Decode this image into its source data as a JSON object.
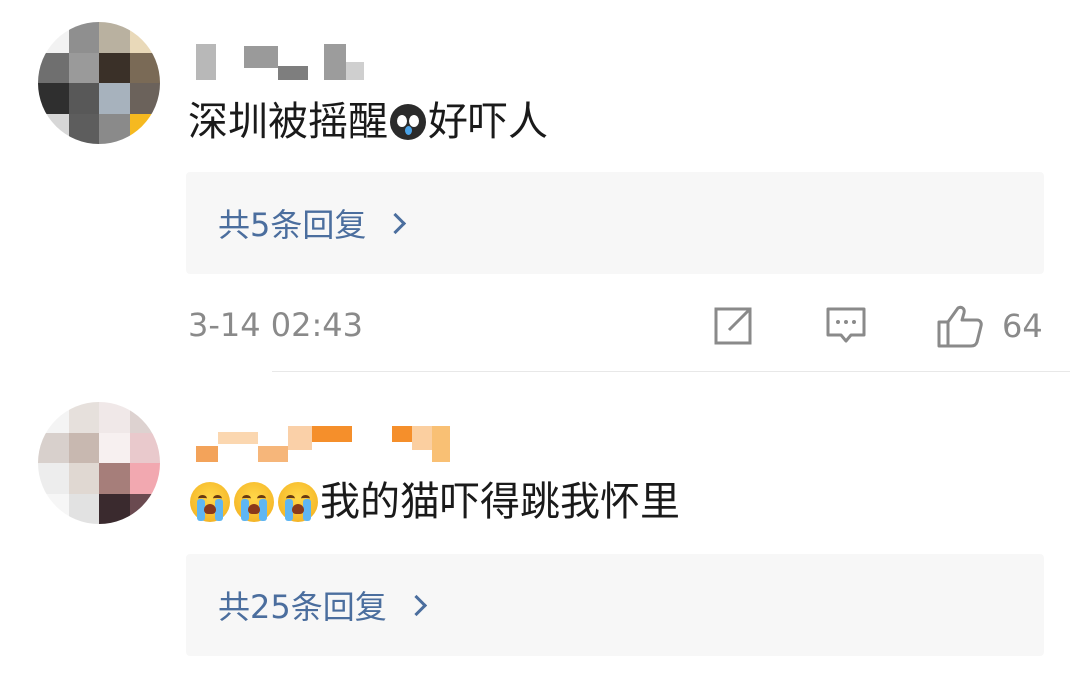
{
  "comments": [
    {
      "text_before_emoji": "深圳被摇醒",
      "emoji_name": "dark-crying-face",
      "text_after_emoji": "好吓人",
      "reply_label": "共5条回复",
      "timestamp": "3-14 02:43",
      "like_count": "64"
    },
    {
      "emoji_names": [
        "crying-face",
        "crying-face",
        "crying-face"
      ],
      "text": "我的猫吓得跳我怀里",
      "reply_label": "共25条回复"
    }
  ],
  "icons": {
    "share": "share-icon",
    "comment": "comment-icon",
    "like": "thumbs-up-icon",
    "chevron": "chevron-right-icon"
  },
  "colors": {
    "link": "#4b6e9e",
    "meta_text": "#8a8a8a",
    "reply_bg": "#f7f7f7"
  }
}
